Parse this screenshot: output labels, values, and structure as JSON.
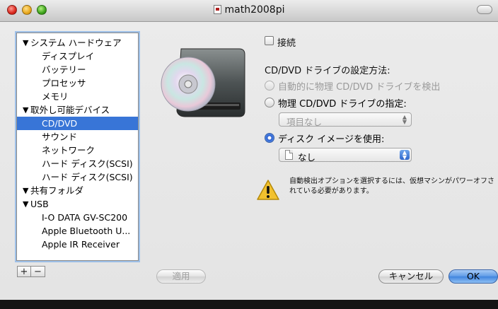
{
  "window": {
    "title": "math2008pi"
  },
  "sidebar": {
    "items": [
      {
        "label": "システム ハードウェア",
        "indent": 0,
        "expanded": true,
        "selected": false
      },
      {
        "label": "ディスプレイ",
        "indent": 1,
        "selected": false
      },
      {
        "label": "バッテリー",
        "indent": 1,
        "selected": false
      },
      {
        "label": "プロセッサ",
        "indent": 1,
        "selected": false
      },
      {
        "label": "メモリ",
        "indent": 1,
        "selected": false
      },
      {
        "label": "取外し可能デバイス",
        "indent": 0,
        "expanded": true,
        "selected": false
      },
      {
        "label": "CD/DVD",
        "indent": 1,
        "selected": true
      },
      {
        "label": "サウンド",
        "indent": 1,
        "selected": false
      },
      {
        "label": "ネットワーク",
        "indent": 1,
        "selected": false
      },
      {
        "label": "ハード ディスク(SCSI)",
        "indent": 1,
        "selected": false
      },
      {
        "label": "ハード ディスク(SCSI)",
        "indent": 1,
        "selected": false
      },
      {
        "label": "共有フォルダ",
        "indent": 0,
        "expanded": true,
        "selected": false
      },
      {
        "label": "USB",
        "indent": 0,
        "expanded": true,
        "selected": false
      },
      {
        "label": "I-O DATA GV-SC200",
        "indent": 1,
        "selected": false
      },
      {
        "label": "Apple Bluetooth U...",
        "indent": 1,
        "selected": false
      },
      {
        "label": "Apple IR Receiver",
        "indent": 1,
        "selected": false
      }
    ],
    "add_label": "+",
    "remove_label": "−"
  },
  "settings": {
    "connect_label": "接続",
    "connect_checked": false,
    "section_label": "CD/DVD ドライブの設定方法:",
    "radio_auto": "自動的に物理 CD/DVD ドライブを検出",
    "radio_physical": "物理 CD/DVD ドライブの指定:",
    "physical_popup_value": "項目なし",
    "radio_image": "ディスク イメージを使用:",
    "image_popup_value": "なし",
    "selected_option": "image",
    "warning_text": "自動検出オプションを選択するには、仮想マシンがパワーオフされている必要があります。"
  },
  "buttons": {
    "apply": "適用",
    "cancel": "キャンセル",
    "ok": "OK"
  },
  "colors": {
    "selection": "#3875d7",
    "default_button": "#5d9ae6",
    "warning": "#f2c12e"
  }
}
